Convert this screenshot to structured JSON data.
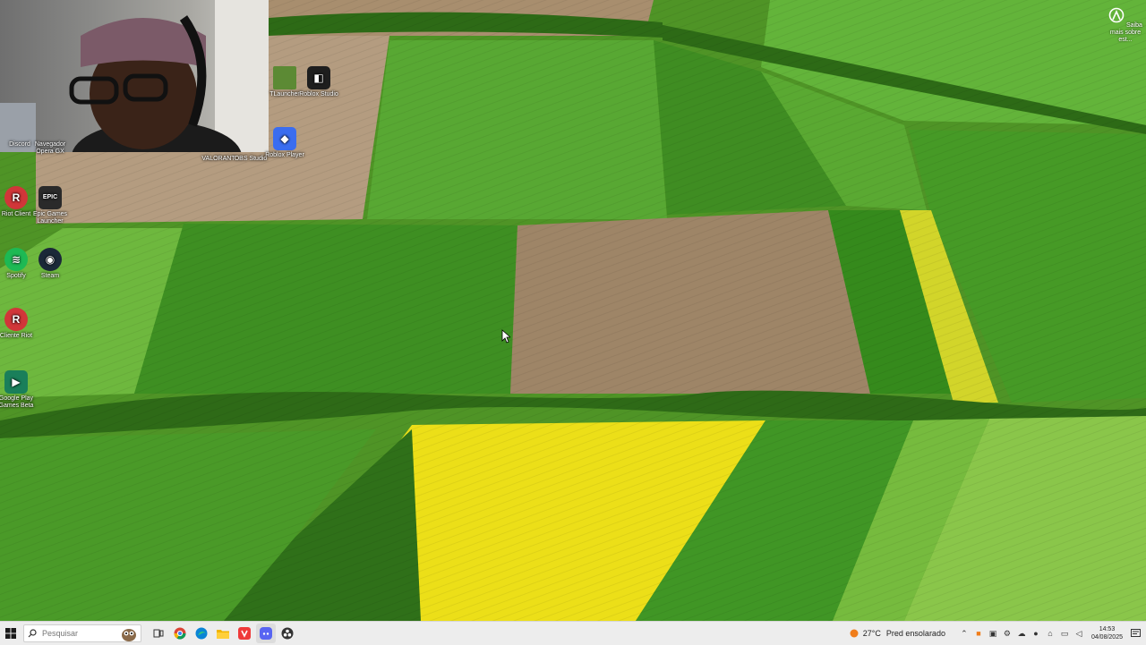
{
  "desktop_icons": [
    {
      "id": "discord",
      "label": "Discord",
      "color": "#5865f2",
      "glyph": ""
    },
    {
      "id": "opera-gx",
      "label": "Navegador Opera GX",
      "color": "#1d1d2b",
      "glyph": ""
    },
    {
      "id": "riot-client",
      "label": "Riot Client",
      "color": "#d13639",
      "glyph": "R"
    },
    {
      "id": "epic",
      "label": "Epic Games Launcher",
      "color": "#2a2a2a",
      "glyph": "EPIC"
    },
    {
      "id": "spotify",
      "label": "Spotify",
      "color": "#1db954",
      "glyph": "≋"
    },
    {
      "id": "steam",
      "label": "Steam",
      "color": "#1b2838",
      "glyph": "◉"
    },
    {
      "id": "cliente-riot",
      "label": "Cliente Riot",
      "color": "#d13639",
      "glyph": "R"
    },
    {
      "id": "google-play",
      "label": "Google Play Games Beta",
      "color": "#1a7f5a",
      "glyph": "▶"
    },
    {
      "id": "valorant",
      "label": "VALORANT",
      "color": "#c23a42",
      "glyph": ""
    },
    {
      "id": "obs",
      "label": "OBS Studio",
      "color": "#2f2f2f",
      "glyph": ""
    },
    {
      "id": "tlauncher",
      "label": "TLauncher",
      "color": "#5c8a34",
      "glyph": ""
    },
    {
      "id": "roblox-studio",
      "label": "Roblox Studio",
      "color": "#1e1e1e",
      "glyph": "◧"
    },
    {
      "id": "roblox-player",
      "label": "Roblox Player",
      "color": "#3a6df0",
      "glyph": "◆"
    }
  ],
  "tip": {
    "label": "Saiba mais sobre est..."
  },
  "taskbar": {
    "search_placeholder": "Pesquisar",
    "apps": [
      {
        "id": "task-view",
        "color": "#444"
      },
      {
        "id": "chrome",
        "color": "#db4437"
      },
      {
        "id": "edge",
        "color": "#0a84d6"
      },
      {
        "id": "explorer",
        "color": "#f1b500"
      },
      {
        "id": "vivaldi",
        "color": "#ef3939"
      },
      {
        "id": "discord",
        "color": "#5865f2"
      },
      {
        "id": "obs",
        "color": "#333"
      }
    ]
  },
  "tray": {
    "weather_temp": "27°C",
    "weather_desc": "Pred ensolarado",
    "time": "14:53",
    "date": "04/08/2025",
    "accent": "#f07d1a"
  }
}
